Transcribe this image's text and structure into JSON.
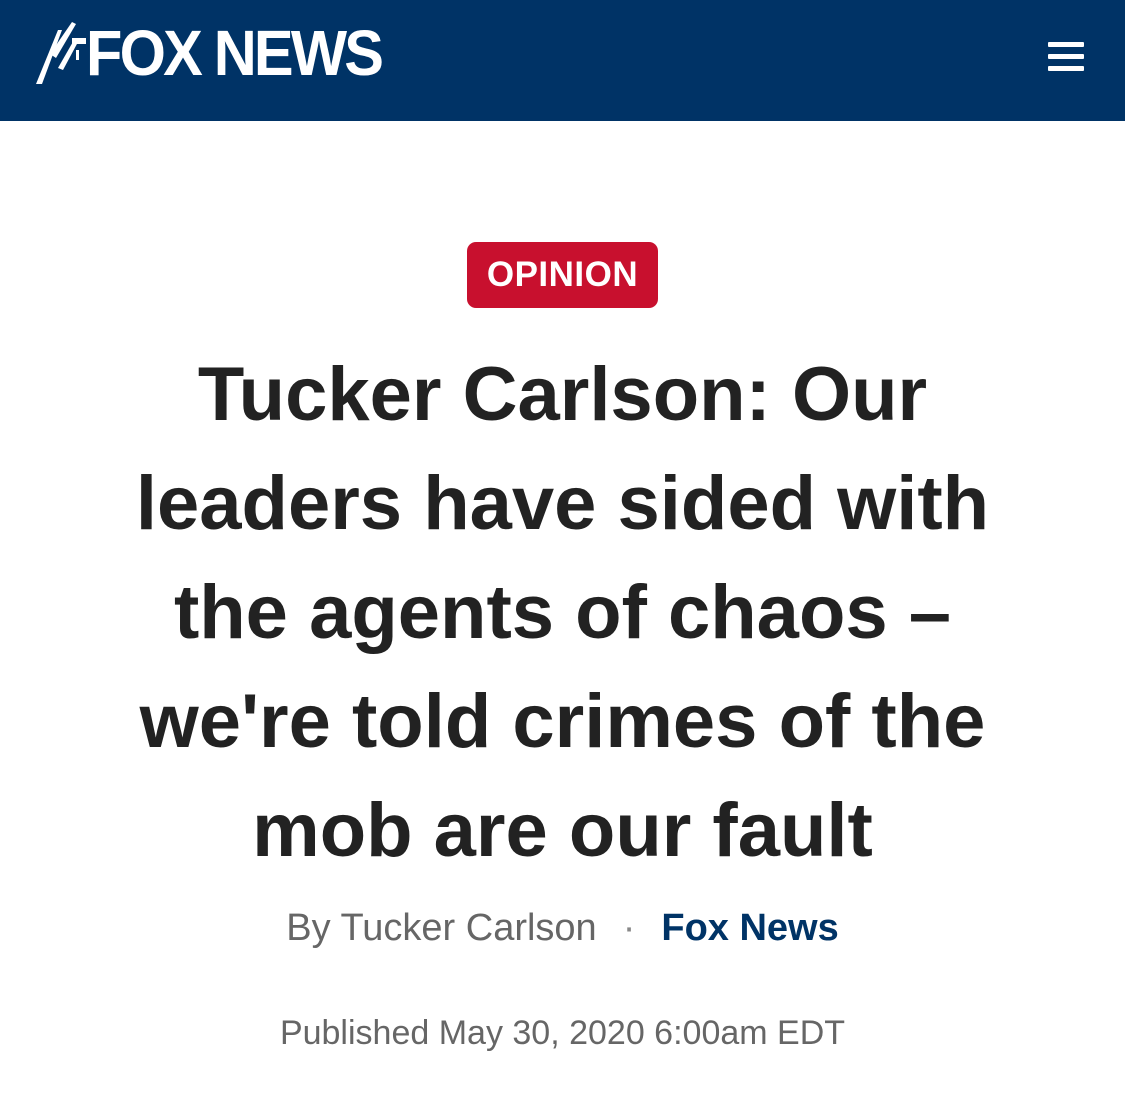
{
  "header": {
    "logo_text": "FOX NEWS",
    "logo_icon": "fox-news-searchlight-icon",
    "menu_icon": "hamburger-menu-icon",
    "background_color": "#003366"
  },
  "article": {
    "category_badge": "OPINION",
    "badge_color": "#c8102e",
    "headline_lines": [
      "Tucker Carlson: Our",
      "leaders have sided with",
      "the agents of chaos –",
      "we're told crimes of the",
      "mob are our fault"
    ],
    "byline": {
      "author": "By Tucker Carlson",
      "separator": "·",
      "source": "Fox News"
    },
    "published": "Published May 30, 2020 6:00am EDT"
  }
}
